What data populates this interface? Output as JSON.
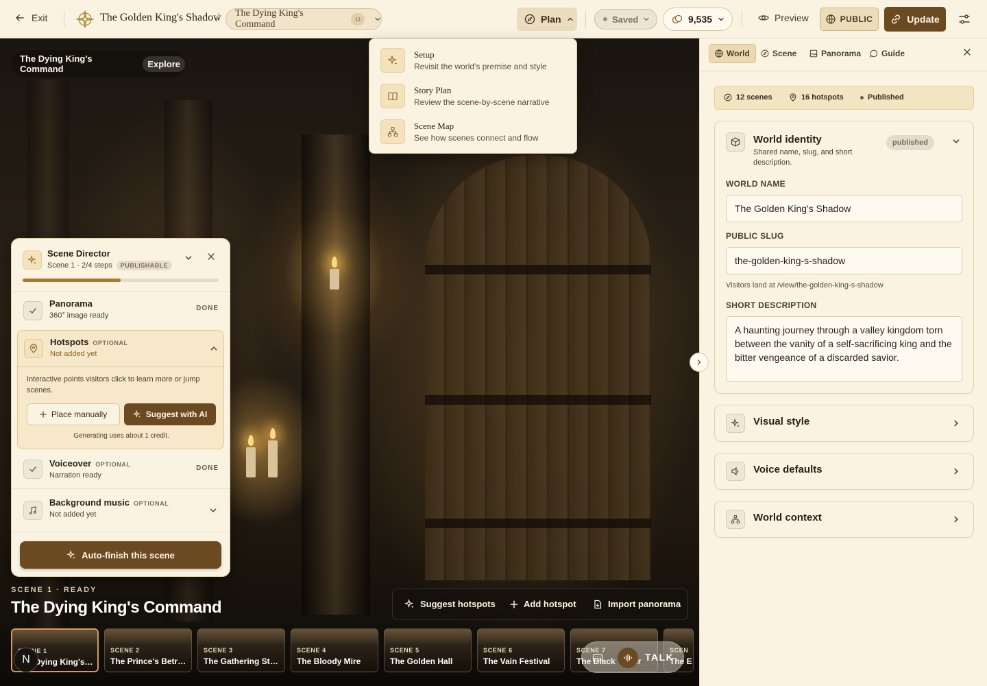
{
  "topbar": {
    "exit_label": "Exit",
    "world_title": "The Golden King's Shadow",
    "scene_title": "The Dying King's Command",
    "scene_count": "12",
    "plan_label": "Plan",
    "saved_label": "Saved",
    "credits": "9,535",
    "preview_label": "Preview",
    "public_label": "PUBLIC",
    "update_label": "Update"
  },
  "plan_menu": {
    "items": [
      {
        "title": "Setup",
        "desc": "Revisit the world's premise and style",
        "icon": "sparkles-icon"
      },
      {
        "title": "Story Plan",
        "desc": "Review the scene-by-scene narrative",
        "icon": "book-icon"
      },
      {
        "title": "Scene Map",
        "desc": "See how scenes connect and flow",
        "icon": "network-icon"
      }
    ]
  },
  "viewport": {
    "crumb_title": "The Dying King's Command",
    "crumb_mode": "Explore",
    "scene_status": "SCENE 1 · READY",
    "scene_title": "The Dying King's Command"
  },
  "director": {
    "title": "Scene Director",
    "subtitle": "Scene 1 · 2/4 steps",
    "badge": "PUBLISHABLE",
    "progress": 0.5,
    "steps": [
      {
        "title": "Panorama",
        "optional": "",
        "sub": "360° image ready",
        "status": "DONE"
      },
      {
        "title": "Hotspots",
        "optional": "OPTIONAL",
        "sub": "Not added yet",
        "status": ""
      },
      {
        "title": "Voiceover",
        "optional": "OPTIONAL",
        "sub": "Narration ready",
        "status": "DONE"
      },
      {
        "title": "Background music",
        "optional": "OPTIONAL",
        "sub": "Not added yet",
        "status": ""
      }
    ],
    "hotspot_desc": "Interactive points visitors click to learn more or jump scenes.",
    "place_manually": "Place manually",
    "suggest_ai": "Suggest with AI",
    "credit_note": "Generating uses about 1 credit.",
    "autofinish": "Auto-finish this scene"
  },
  "action_bar": {
    "suggest": "Suggest hotspots",
    "add": "Add hotspot",
    "import": "Import panorama"
  },
  "filmstrip": [
    {
      "label": "SCENE 1",
      "name": "The Dying King's Command"
    },
    {
      "label": "SCENE 2",
      "name": "The Prince's Betrayal"
    },
    {
      "label": "SCENE 3",
      "name": "The Gathering Storm"
    },
    {
      "label": "SCENE 4",
      "name": "The Bloody Mire"
    },
    {
      "label": "SCENE 5",
      "name": "The Golden Hall"
    },
    {
      "label": "SCENE 6",
      "name": "The Vain Festival"
    },
    {
      "label": "SCENE 7",
      "name": "The Black Tower"
    },
    {
      "label": "SCEN",
      "name": "The E"
    }
  ],
  "badge_letter": "N",
  "talk_label": "TALK",
  "panel": {
    "tabs": [
      {
        "label": "World",
        "icon": "globe-icon"
      },
      {
        "label": "Scene",
        "icon": "compass-icon"
      },
      {
        "label": "Panorama",
        "icon": "image-icon"
      },
      {
        "label": "Guide",
        "icon": "chat-icon"
      }
    ],
    "stats": {
      "scenes": "12 scenes",
      "hotspots": "16 hotspots",
      "status": "Published"
    },
    "identity": {
      "title": "World identity",
      "desc": "Shared name, slug, and short description.",
      "badge": "published",
      "name_label": "WORLD NAME",
      "name_value": "The Golden King's Shadow",
      "slug_label": "PUBLIC SLUG",
      "slug_value": "the-golden-king-s-shadow",
      "slug_hint": "Visitors land at /view/the-golden-king-s-shadow",
      "desc_label": "SHORT DESCRIPTION",
      "desc_value": "A haunting journey through a valley kingdom torn between the vanity of a self-sacrificing king and the bitter vengeance of a discarded savior."
    },
    "sections": [
      {
        "title": "Visual style",
        "icon": "sparkles-icon"
      },
      {
        "title": "Voice defaults",
        "icon": "speaker-icon"
      },
      {
        "title": "World context",
        "icon": "network-icon"
      }
    ]
  },
  "colors": {
    "accent": "#6b4a22",
    "background": "#fbf3e2",
    "gold": "#a67a30"
  }
}
